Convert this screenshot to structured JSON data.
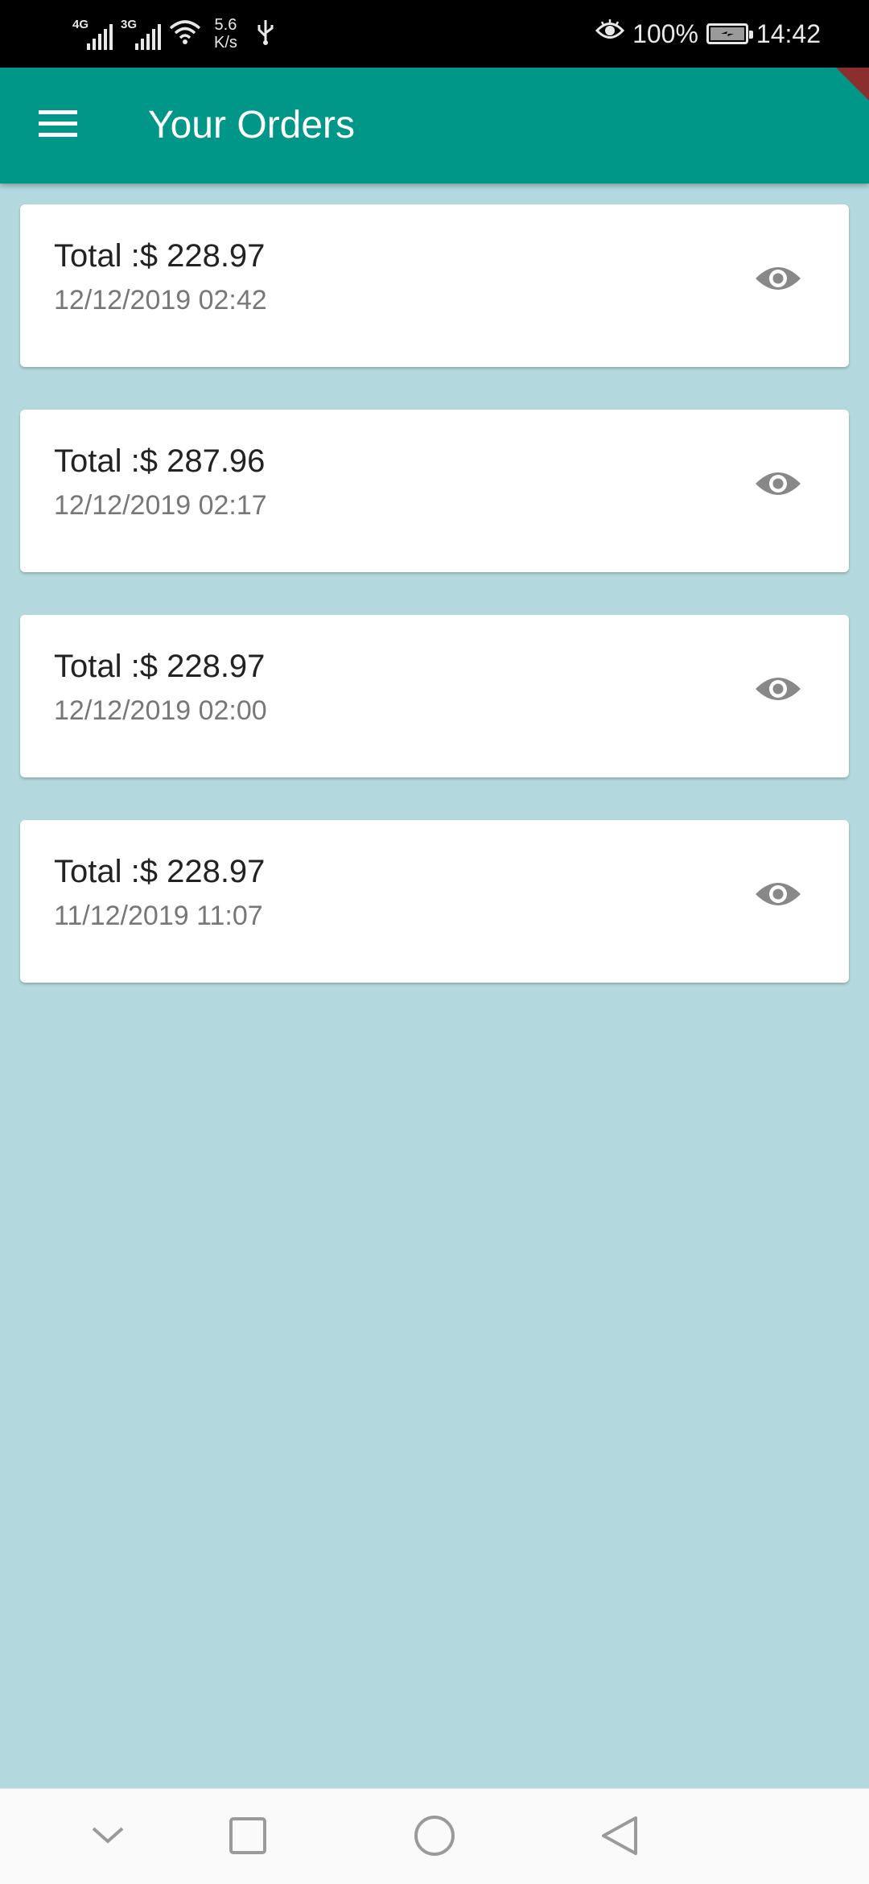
{
  "status_bar": {
    "network_1": "4G",
    "network_2": "3G",
    "speed_value": "5.6",
    "speed_unit": "K/s",
    "battery": "100%",
    "time": "14:42"
  },
  "appbar": {
    "title": "Your Orders",
    "menu_icon": "menu-icon",
    "color": "#009688"
  },
  "orders": [
    {
      "total": "Total :$ 228.97",
      "date": "12/12/2019 02:42"
    },
    {
      "total": "Total :$ 287.96",
      "date": "12/12/2019 02:17"
    },
    {
      "total": "Total :$ 228.97",
      "date": "12/12/2019 02:00"
    },
    {
      "total": "Total :$ 228.97",
      "date": "11/12/2019 11:07"
    }
  ],
  "order_action_icon": "eye-icon",
  "navbar": {
    "icons": [
      "chevron-down-icon",
      "square-icon",
      "circle-icon",
      "triangle-back-icon"
    ]
  },
  "colors": {
    "background": "#b3d8dd",
    "card": "#ffffff",
    "icon": "#888888"
  }
}
